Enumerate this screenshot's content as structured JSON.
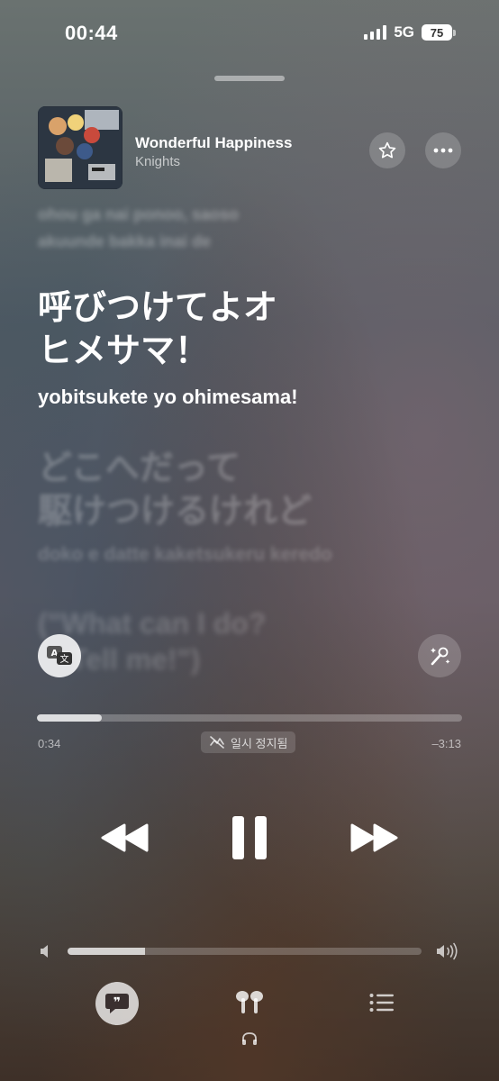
{
  "status_bar": {
    "time": "00:44",
    "network": "5G",
    "battery": "75"
  },
  "now_playing": {
    "title": "Wonderful Happiness",
    "artist": "Knights"
  },
  "lyrics": {
    "previous": [
      "ohou ga nai ponoo, saoso",
      "akuunde bakka inai de"
    ],
    "current": {
      "line1": "呼びつけてよオ",
      "line2": "ヒメサマ！",
      "romaji": "yobitsukete yo ohimesama!"
    },
    "next": {
      "line1": "どこへだって",
      "line2": "駆けつけるけれど",
      "romaji": "doko e datte kaketsukeru keredo",
      "line3": "(\"What can I do?",
      "line4": "Tell me!\")"
    }
  },
  "playback": {
    "elapsed": "0:34",
    "remaining": "–3:13",
    "progress_fraction": 0.153,
    "status_label": "일시 정지됨",
    "volume_fraction": 0.22
  },
  "icons": {
    "favorite": "star-icon",
    "more": "more-icon",
    "translate": "translate-icon",
    "sing": "microphone-sparkle-icon",
    "rewind": "rewind-icon",
    "pause": "pause-icon",
    "forward": "fast-forward-icon",
    "lyrics": "quote-bubble-icon",
    "airpods": "airpods-icon",
    "queue": "list-icon"
  }
}
